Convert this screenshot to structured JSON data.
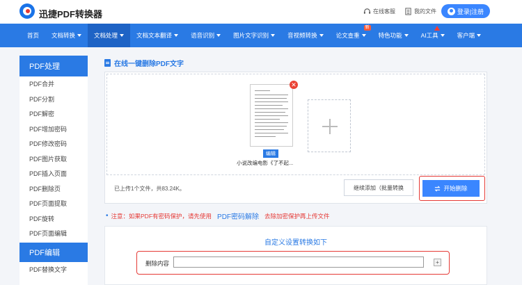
{
  "header": {
    "logo_text": "迅捷PDF转换器",
    "support_label": "在线客服",
    "files_label": "我的文件",
    "login_label": "登录|注册"
  },
  "nav": {
    "items": [
      {
        "label": "首页",
        "caret": false
      },
      {
        "label": "文档转换",
        "caret": true
      },
      {
        "label": "文档处理",
        "caret": true,
        "active": true
      },
      {
        "label": "文档文本翻译",
        "caret": true
      },
      {
        "label": "语音识别",
        "caret": true
      },
      {
        "label": "图片文字识别",
        "caret": true
      },
      {
        "label": "音视频转换",
        "caret": true
      },
      {
        "label": "论文查重",
        "caret": true,
        "badge": "新"
      },
      {
        "label": "特色功能",
        "caret": true
      },
      {
        "label": "AI工具",
        "caret": true,
        "flag": true
      },
      {
        "label": "客户端",
        "caret": true
      }
    ]
  },
  "sidebar": {
    "section1": "PDF处理",
    "items": [
      "PDF合并",
      "PDF分割",
      "PDF解密",
      "PDF增加密码",
      "PDF修改密码",
      "PDF图片获取",
      "PDF插入页面",
      "PDF删除页",
      "PDF页面提取",
      "PDF旋转",
      "PDF页面编辑"
    ],
    "section2": "PDF编辑",
    "items2": [
      "PDF替换文字"
    ]
  },
  "main": {
    "title": "在线一键删除PDF文字",
    "file": {
      "edit_tag": "编辑",
      "name": "小说改编电影《了不起..."
    },
    "upload_info": "已上传1个文件，共83.24K。",
    "add_more_label": "继续添加（批量转换",
    "start_label": "开始删除",
    "notice": {
      "prefix": "注意：如果PDF有密码保护，请先使用",
      "link": "PDF密码解除",
      "suffix": "去除加密保护再上传文件"
    },
    "settings": {
      "title": "自定义设置转换如下",
      "delete_label": "删除内容",
      "delete_value": "",
      "plus": "+"
    }
  },
  "colors": {
    "primary": "#2a7ae4",
    "button": "#3a86ff",
    "highlight": "#e53935"
  }
}
